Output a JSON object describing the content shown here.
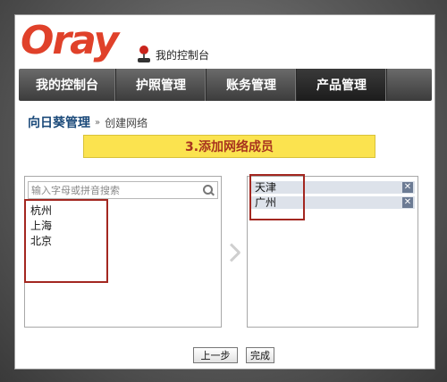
{
  "header": {
    "logo_text": "Oray",
    "console_link": "我的控制台"
  },
  "nav": {
    "items": [
      {
        "label": "我的控制台"
      },
      {
        "label": "护照管理"
      },
      {
        "label": "账务管理"
      },
      {
        "label": "产品管理",
        "active": true
      }
    ]
  },
  "breadcrumb": {
    "main": "向日葵管理",
    "separator": "»",
    "sub": "创建网络"
  },
  "step": {
    "title": "3.添加网络成员"
  },
  "search": {
    "placeholder": "输入字母或拼音搜索",
    "value": ""
  },
  "available_cities": [
    "杭州",
    "上海",
    "北京"
  ],
  "selected_cities": [
    "天津",
    "广州"
  ],
  "icons": {
    "search": "search-icon",
    "remove": "close-icon",
    "arrow": "chevron-right-icon",
    "console": "joystick-icon"
  },
  "buttons": {
    "prev": "上一步",
    "done": "完成"
  },
  "colors": {
    "brand": "#e0412a",
    "banner_bg": "#fbe34f",
    "banner_text": "#a8331e",
    "highlight": "#a32720",
    "selected_row": "#dde2ea"
  }
}
